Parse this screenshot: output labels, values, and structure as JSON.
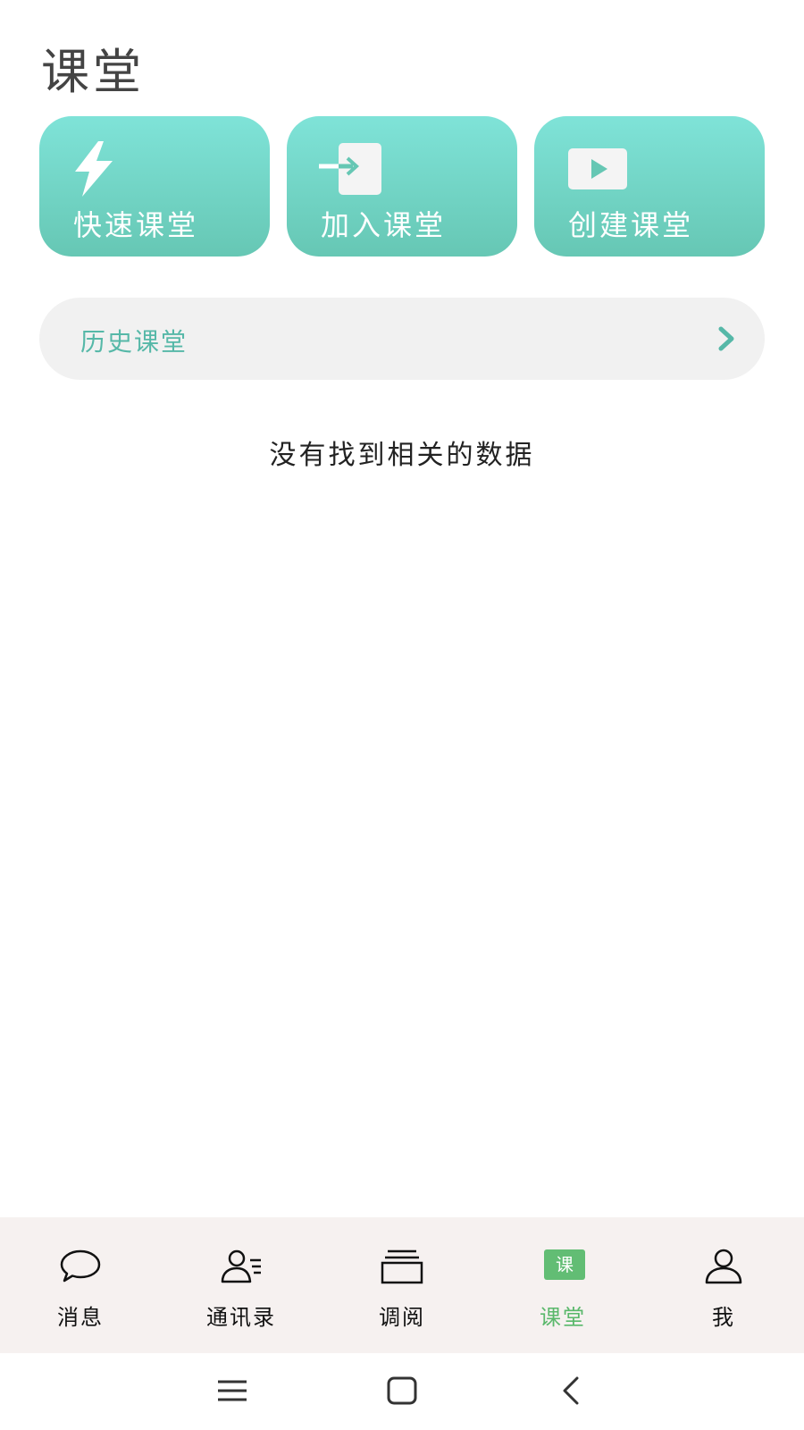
{
  "page": {
    "title": "课堂"
  },
  "actions": [
    {
      "label": "快速课堂",
      "icon": "lightning-icon"
    },
    {
      "label": "加入课堂",
      "icon": "enter-door-icon"
    },
    {
      "label": "创建课堂",
      "icon": "video-play-icon"
    }
  ],
  "history": {
    "label": "历史课堂",
    "icon": "chevron-right-icon"
  },
  "empty_state": {
    "text": "没有找到相关的数据"
  },
  "tabbar": {
    "items": [
      {
        "label": "消息",
        "icon": "chat-bubble-icon",
        "active": false
      },
      {
        "label": "通讯录",
        "icon": "contacts-icon",
        "active": false
      },
      {
        "label": "调阅",
        "icon": "folder-stack-icon",
        "active": false
      },
      {
        "label": "课堂",
        "icon": "class-badge-icon",
        "badge": "课",
        "active": true
      },
      {
        "label": "我",
        "icon": "person-icon",
        "active": false
      }
    ]
  },
  "colors": {
    "accent": "#66c7b4",
    "accent_light": "#7fe3d8",
    "history_text": "#56b8a8",
    "tab_active": "#5ab86b",
    "tabbar_bg": "#f6f1f0"
  },
  "system_nav": [
    {
      "icon": "menu-lines-icon"
    },
    {
      "icon": "home-square-icon"
    },
    {
      "icon": "back-chevron-icon"
    }
  ]
}
